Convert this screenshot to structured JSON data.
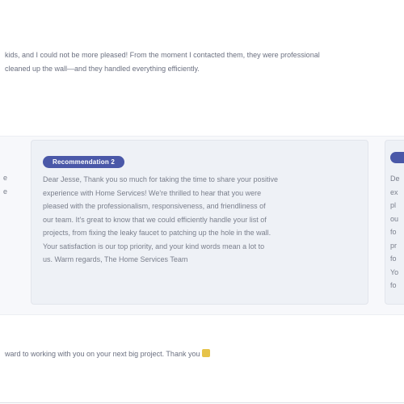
{
  "review": {
    "lines": [
      "kids, and I could not be more pleased! From the moment I contacted them, they were professional",
      "cleaned up the wall—and they handled everything efficiently."
    ]
  },
  "recommendation": {
    "badge": "Recommendation 2",
    "lines": [
      "Dear Jesse, Thank you so much for taking the time to share your positive",
      "experience with Home Services! We're thrilled to hear that you were",
      "pleased with the professionalism, responsiveness, and friendliness of",
      "our team. It's great to know that we could efficiently handle your list of",
      "projects, from fixing the leaky faucet to patching up the hole in the wall.",
      "Your satisfaction is our top priority, and your kind words mean a lot to",
      "us. Warm regards, The Home Services Team"
    ]
  },
  "side_card_left": {
    "lines": [
      "e",
      "",
      "",
      "",
      "e",
      "",
      ""
    ]
  },
  "side_card_right": {
    "lines": [
      "De",
      "ex",
      "pl",
      "ou",
      "fo",
      "pr",
      "fo",
      "Yo",
      "fo"
    ]
  },
  "footer": {
    "text": "ward to working with you on your next big project. Thank you"
  },
  "icons": {
    "emoji": "grinning-face-icon"
  }
}
